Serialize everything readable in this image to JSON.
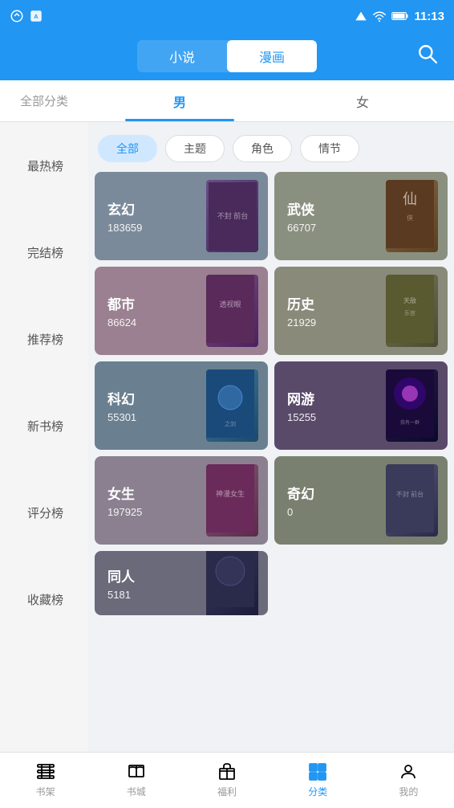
{
  "statusBar": {
    "time": "11:13"
  },
  "topNav": {
    "tabs": [
      {
        "id": "novel",
        "label": "小说",
        "active": false
      },
      {
        "id": "manga",
        "label": "漫画",
        "active": true
      }
    ],
    "searchLabel": "搜索"
  },
  "categoryTabs": [
    {
      "id": "all",
      "label": "全部分类",
      "active": false
    },
    {
      "id": "male",
      "label": "男",
      "active": true
    },
    {
      "id": "female",
      "label": "女",
      "active": false
    }
  ],
  "filterPills": [
    {
      "id": "all",
      "label": "全部",
      "active": true
    },
    {
      "id": "theme",
      "label": "主题",
      "active": false
    },
    {
      "id": "role",
      "label": "角色",
      "active": false
    },
    {
      "id": "plot",
      "label": "情节",
      "active": false
    }
  ],
  "sidebarItems": [
    {
      "id": "hot",
      "label": "最热榜",
      "active": false
    },
    {
      "id": "complete",
      "label": "完结榜",
      "active": false
    },
    {
      "id": "recommend",
      "label": "推荐榜",
      "active": false
    },
    {
      "id": "new",
      "label": "新书榜",
      "active": false
    },
    {
      "id": "score",
      "label": "评分榜",
      "active": false
    },
    {
      "id": "collect",
      "label": "收藏榜",
      "active": false
    }
  ],
  "genreCards": [
    {
      "id": "xuanhuan",
      "name": "玄幻",
      "count": "183659",
      "coverClass": "cover-xuanhuan",
      "bgClass": "card-bg-1"
    },
    {
      "id": "wuxia",
      "name": "武侠",
      "count": "66707",
      "coverClass": "cover-wuxia",
      "bgClass": "card-bg-2"
    },
    {
      "id": "dushi",
      "name": "都市",
      "count": "86624",
      "coverClass": "cover-dushi",
      "bgClass": "card-bg-3"
    },
    {
      "id": "lishi",
      "name": "历史",
      "count": "21929",
      "coverClass": "cover-lishi",
      "bgClass": "card-bg-4"
    },
    {
      "id": "kehuan",
      "name": "科幻",
      "count": "55301",
      "coverClass": "cover-kehuan",
      "bgClass": "card-bg-5"
    },
    {
      "id": "wangyou",
      "name": "网游",
      "count": "15255",
      "coverClass": "cover-wangyou",
      "bgClass": "card-bg-6"
    },
    {
      "id": "nvsheng",
      "name": "女生",
      "count": "197925",
      "coverClass": "cover-nvsheng",
      "bgClass": "card-bg-7"
    },
    {
      "id": "qihuan",
      "name": "奇幻",
      "count": "0",
      "coverClass": "cover-qihuan",
      "bgClass": "card-bg-8"
    },
    {
      "id": "tongren",
      "name": "同人",
      "count": "5181",
      "coverClass": "cover-tongren",
      "bgClass": "card-bg-9"
    }
  ],
  "bottomNav": [
    {
      "id": "bookshelf",
      "label": "书架",
      "active": false
    },
    {
      "id": "bookstore",
      "label": "书城",
      "active": false
    },
    {
      "id": "welfare",
      "label": "福利",
      "active": false
    },
    {
      "id": "category",
      "label": "分类",
      "active": true
    },
    {
      "id": "mine",
      "label": "我的",
      "active": false
    }
  ]
}
